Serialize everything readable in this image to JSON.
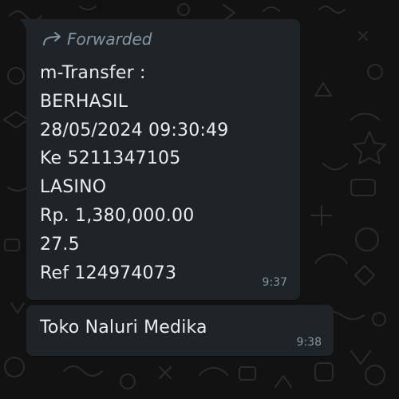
{
  "colors": {
    "background": "#121212",
    "bubble": "#1f2428",
    "text": "#e9edef",
    "meta_text": "#8696a0",
    "wallpaper_doodle": "#2a2a2a"
  },
  "messages": [
    {
      "forwarded_label": "Forwarded",
      "forwarded_icon": "forward-arrow-icon",
      "lines": [
        "m-Transfer :",
        "BERHASIL",
        "28/05/2024 09:30:49",
        "Ke 5211347105",
        "LASINO",
        "Rp. 1,380,000.00",
        "27.5",
        "Ref 124974073"
      ],
      "time": "9:37"
    },
    {
      "text": "Toko Naluri Medika",
      "time": "9:38"
    }
  ]
}
